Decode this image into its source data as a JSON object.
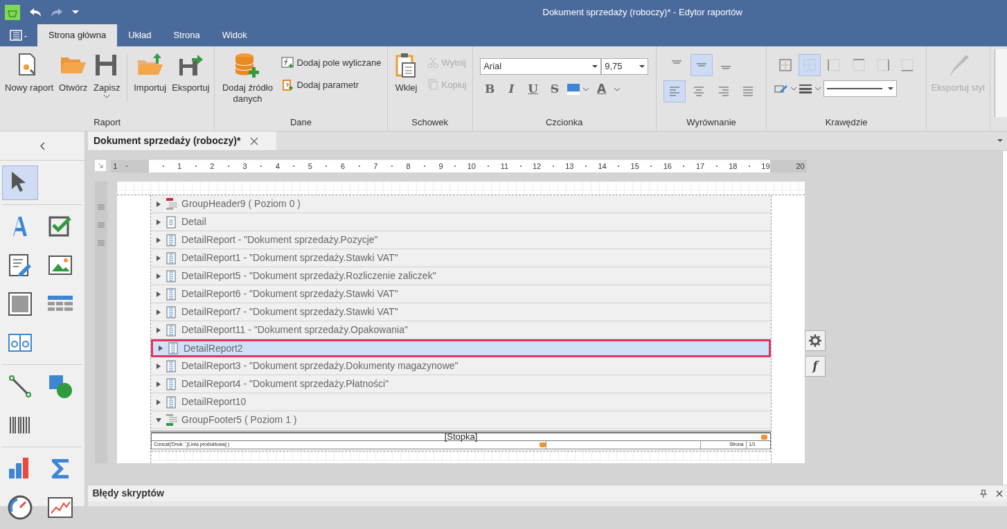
{
  "window": {
    "title": "Dokument sprzedaży (roboczy)* - Edytor raportów"
  },
  "ribbon": {
    "tabs": [
      {
        "label": "Strona główna",
        "selected": true
      },
      {
        "label": "Układ",
        "selected": false
      },
      {
        "label": "Strona",
        "selected": false
      },
      {
        "label": "Widok",
        "selected": false
      }
    ],
    "groups": [
      {
        "kind": "buttons",
        "label": "Raport",
        "sets": [
          [
            {
              "label": "Nowy raport",
              "disabled": false,
              "dropdown": false
            },
            {
              "label": "Otwórz",
              "disabled": false,
              "dropdown": false
            },
            {
              "label": "Zapisz",
              "disabled": false,
              "dropdown": true
            }
          ],
          [
            {
              "label": "Importuj",
              "disabled": false,
              "dropdown": false
            },
            {
              "label": "Eksportuj",
              "disabled": false,
              "dropdown": false
            }
          ]
        ]
      },
      {
        "kind": "buttons",
        "label": "Dane",
        "sets": [
          [
            {
              "label": "Dodaj źródło danych",
              "disabled": false,
              "dropdown": false
            }
          ]
        ],
        "small": [
          {
            "label": "Dodaj pole wyliczane",
            "disabled": false
          },
          {
            "label": "Dodaj parametr",
            "disabled": false
          }
        ]
      },
      {
        "kind": "buttons",
        "label": "Schowek",
        "sets": [
          [
            {
              "label": "Wklej",
              "disabled": false,
              "dropdown": false
            }
          ]
        ],
        "small": [
          {
            "label": "Wytnij",
            "disabled": true
          },
          {
            "label": "Kopiuj",
            "disabled": true
          }
        ]
      },
      {
        "kind": "font",
        "label": "Czcionka",
        "font": "Arial",
        "size": "9,75",
        "styles": [
          {
            "label": "B",
            "selected": false
          },
          {
            "label": "I",
            "selected": false
          },
          {
            "label": "U",
            "selected": false
          },
          {
            "label": "S",
            "selected": false
          }
        ],
        "font_color": "A"
      },
      {
        "kind": "align",
        "label": "Wyrównanie",
        "vertical": [
          {
            "selected": false
          },
          {
            "selected": true
          },
          {
            "selected": false
          }
        ],
        "horizontal": [
          {
            "selected": true
          },
          {
            "selected": false
          },
          {
            "selected": false
          },
          {
            "selected": false
          }
        ]
      },
      {
        "kind": "borders",
        "label": "Krawędzie",
        "borders": [
          {
            "selected": false
          },
          {
            "selected": true
          },
          {
            "selected": false
          },
          {
            "selected": false
          },
          {
            "selected": false
          },
          {
            "selected": false
          }
        ]
      },
      {
        "kind": "buttons",
        "sets": [
          [
            {
              "label": "Eksportuj styl",
              "disabled": true,
              "dropdown": false
            }
          ]
        ]
      }
    ]
  },
  "toolbox": {
    "tools": [
      {
        "selected": true
      },
      {
        "selected": false
      },
      {
        "selected": false
      },
      {
        "selected": false
      },
      {
        "selected": false
      },
      {
        "selected": false
      },
      {
        "selected": false
      },
      {
        "selected": false
      },
      {
        "selected": false
      },
      {
        "selected": false
      },
      {
        "selected": false
      },
      {
        "selected": false
      },
      {
        "selected": false
      },
      {
        "selected": false
      },
      {
        "selected": false
      }
    ]
  },
  "document_tab": {
    "title": "Dokument sprzedaży (roboczy)*"
  },
  "ruler": {
    "labels": [
      "1",
      "1",
      "2",
      "3",
      "4",
      "5",
      "6",
      "7",
      "8",
      "9",
      "10",
      "11",
      "12",
      "13",
      "14",
      "15",
      "16",
      "17",
      "18",
      "19",
      "20"
    ]
  },
  "bands": [
    {
      "kind": "group_header",
      "label": "GroupHeader9 ( Poziom 0 )",
      "expanded": false,
      "selected": false
    },
    {
      "kind": "detail",
      "label": "Detail",
      "expanded": false,
      "selected": false
    },
    {
      "kind": "detail_report",
      "label": "DetailReport - \"Dokument sprzedaży.Pozycje\"",
      "expanded": false,
      "selected": false
    },
    {
      "kind": "detail_report",
      "label": "DetailReport1 - \"Dokument sprzedaży.Stawki VAT\"",
      "expanded": false,
      "selected": false
    },
    {
      "kind": "detail_report",
      "label": "DetailReport5 - \"Dokument sprzedaży.Rozliczenie zaliczek\"",
      "expanded": false,
      "selected": false
    },
    {
      "kind": "detail_report",
      "label": "DetailReport6 - \"Dokument sprzedaży.Stawki VAT\"",
      "expanded": false,
      "selected": false
    },
    {
      "kind": "detail_report",
      "label": "DetailReport7 - \"Dokument sprzedaży.Stawki VAT\"",
      "expanded": false,
      "selected": false
    },
    {
      "kind": "detail_report",
      "label": "DetailReport11 - \"Dokument sprzedaży.Opakowania\"",
      "expanded": false,
      "selected": false
    },
    {
      "kind": "detail_report",
      "label": "DetailReport2",
      "expanded": false,
      "selected": true
    },
    {
      "kind": "detail_report",
      "label": "DetailReport3 - \"Dokument sprzedaży.Dokumenty magazynowe\"",
      "expanded": false,
      "selected": false
    },
    {
      "kind": "detail_report",
      "label": "DetailReport4 - \"Dokument sprzedaży.Płatności\"",
      "expanded": false,
      "selected": false
    },
    {
      "kind": "detail_report",
      "label": "DetailReport10",
      "expanded": false,
      "selected": false
    },
    {
      "kind": "group_footer",
      "label": "GroupFooter5 ( Poziom 1 )",
      "expanded": true,
      "selected": false
    }
  ],
  "footer": {
    "title": "[Stopka]",
    "expression": "Concat('Druk: ',[Linia produktowa] )",
    "page_label": "Strona",
    "page_value": "1/1"
  },
  "band_tools": {
    "function_label": "f"
  },
  "bottom_panel": {
    "title": "Błędy skryptów"
  }
}
